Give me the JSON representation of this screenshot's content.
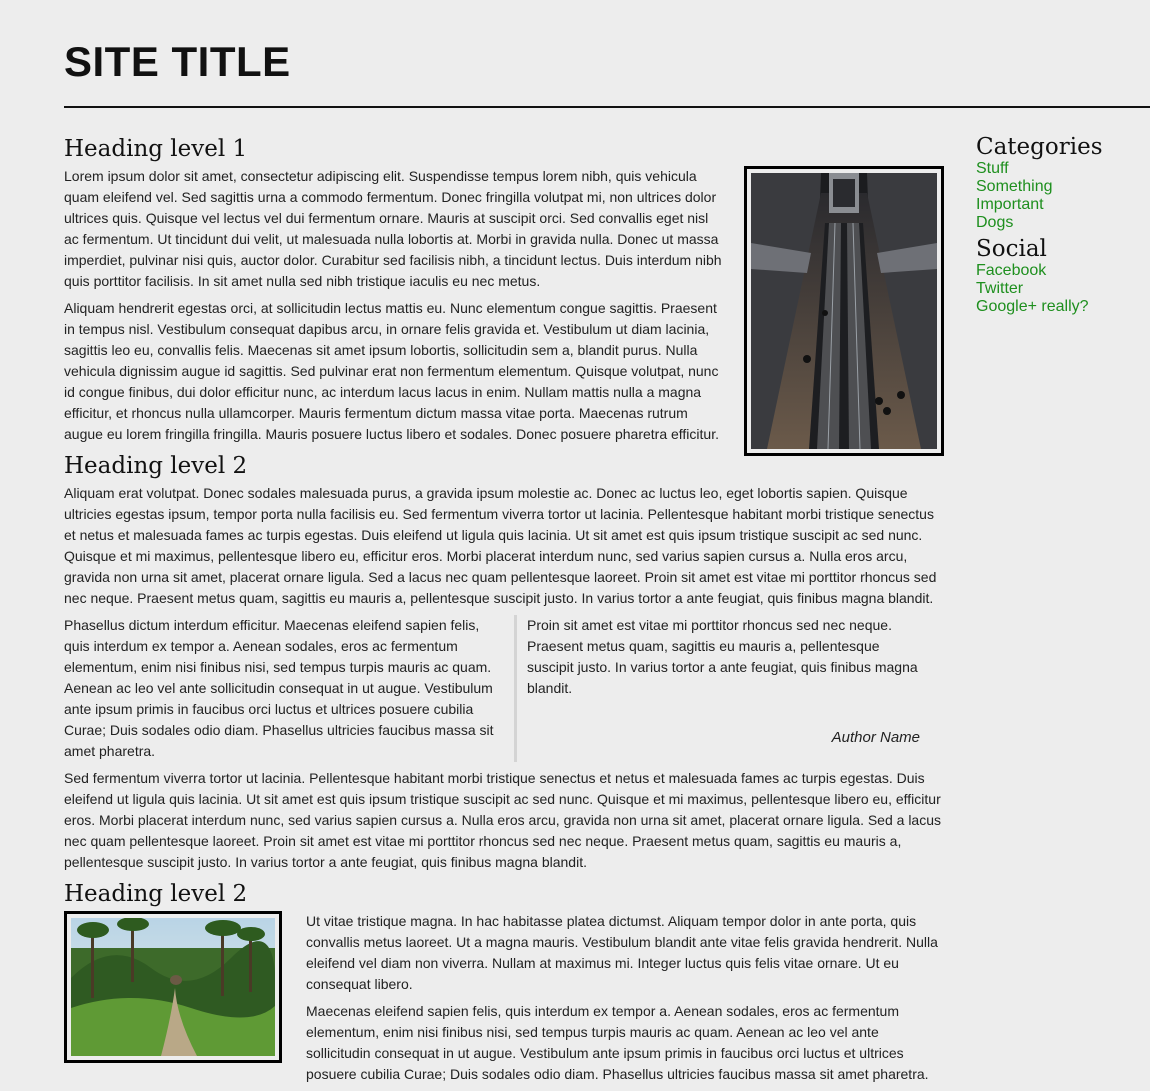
{
  "site": {
    "title": "SITE TITLE"
  },
  "main": {
    "section1": {
      "heading": "Heading level 1",
      "paragraphs": [
        "Lorem ipsum dolor sit amet, consectetur adipiscing elit. Suspendisse tempus lorem nibh, quis vehicula quam eleifend vel. Sed sagittis urna a commodo fermentum. Donec fringilla volutpat mi, non ultrices dolor ultrices quis. Quisque vel lectus vel dui fermentum ornare. Mauris at suscipit orci. Sed convallis eget nisl ac fermentum. Ut tincidunt dui velit, ut malesuada nulla lobortis at. Morbi in gravida nulla. Donec ut massa imperdiet, pulvinar nisi quis, auctor dolor. Curabitur sed facilisis nibh, a tincidunt lectus. Duis interdum nibh quis porttitor facilisis. In sit amet nulla sed nibh tristique iaculis eu nec metus.",
        "Aliquam hendrerit egestas orci, at sollicitudin lectus mattis eu. Nunc elementum congue sagittis. Praesent in tempus nisl. Vestibulum consequat dapibus arcu, in ornare felis gravida et. Vestibulum ut diam lacinia, sagittis leo eu, convallis felis. Maecenas sit amet ipsum lobortis, sollicitudin sem a, blandit purus. Nulla vehicula dignissim augue id sagittis. Sed pulvinar erat non fermentum elementum. Quisque volutpat, nunc id congue finibus, dui dolor efficitur nunc, ac interdum lacus lacus in enim. Nullam mattis nulla a magna efficitur, et rhoncus nulla ullamcorper. Mauris fermentum dictum massa vitae porta. Maecenas rutrum augue eu lorem fringilla fringilla. Mauris posuere luctus libero et sodales. Donec posuere pharetra efficitur."
      ]
    },
    "section2": {
      "heading": "Heading level 2",
      "intro": "Aliquam erat volutpat. Donec sodales malesuada purus, a gravida ipsum molestie ac. Donec ac luctus leo, eget lobortis sapien. Quisque ultricies egestas ipsum, tempor porta nulla facilisis eu. Sed fermentum viverra tortor ut lacinia. Pellentesque habitant morbi tristique senectus et netus et malesuada fames ac turpis egestas. Duis eleifend ut ligula quis lacinia. Ut sit amet est quis ipsum tristique suscipit ac sed nunc. Quisque et mi maximus, pellentesque libero eu, efficitur eros. Morbi placerat interdum nunc, sed varius sapien cursus a. Nulla eros arcu, gravida non urna sit amet, placerat ornare ligula. Sed a lacus nec quam pellentesque laoreet. Proin sit amet est vitae mi porttitor rhoncus sed nec neque. Praesent metus quam, sagittis eu mauris a, pellentesque suscipit justo. In varius tortor a ante feugiat, quis finibus magna blandit.",
      "col_left": "Phasellus dictum interdum efficitur. Maecenas eleifend sapien felis, quis interdum ex tempor a. Aenean sodales, eros ac fermentum elementum, enim nisi finibus nisi, sed tempus turpis mauris ac quam. Aenean ac leo vel ante sollicitudin consequat in ut augue. Vestibulum ante ipsum primis in faucibus orci luctus et ultrices posuere cubilia Curae; Duis sodales odio diam. Phasellus ultricies faucibus massa sit amet pharetra.",
      "quote": "Proin sit amet est vitae mi porttitor rhoncus sed nec neque. Praesent metus quam, sagittis eu mauris a, pellentesque suscipit justo. In varius tortor a ante feugiat, quis finibus magna blandit.",
      "author": "Author Name",
      "outro": "Sed fermentum viverra tortor ut lacinia. Pellentesque habitant morbi tristique senectus et netus et malesuada fames ac turpis egestas. Duis eleifend ut ligula quis lacinia. Ut sit amet est quis ipsum tristique suscipit ac sed nunc. Quisque et mi maximus, pellentesque libero eu, efficitur eros. Morbi placerat interdum nunc, sed varius sapien cursus a. Nulla eros arcu, gravida non urna sit amet, placerat ornare ligula. Sed a lacus nec quam pellentesque laoreet. Proin sit amet est vitae mi porttitor rhoncus sed nec neque. Praesent metus quam, sagittis eu mauris a, pellentesque suscipit justo. In varius tortor a ante feugiat, quis finibus magna blandit."
    },
    "section3": {
      "heading": "Heading level 2",
      "paragraphs": [
        "Ut vitae tristique magna. In hac habitasse platea dictumst. Aliquam tempor dolor in ante porta, quis convallis metus laoreet. Ut a magna mauris. Vestibulum blandit ante vitae felis gravida hendrerit. Nulla eleifend vel diam non viverra. Nullam at maximus mi. Integer luctus quis felis vitae ornare. Ut eu consequat libero.",
        "Maecenas eleifend sapien felis, quis interdum ex tempor a. Aenean sodales, eros ac fermentum elementum, enim nisi finibus nisi, sed tempus turpis mauris ac quam. Aenean ac leo vel ante sollicitudin consequat in ut augue. Vestibulum ante ipsum primis in faucibus orci luctus et ultrices posuere cubilia Curae; Duis sodales odio diam. Phasellus ultricies faucibus massa sit amet pharetra."
      ]
    }
  },
  "sidebar": {
    "categories": {
      "heading": "Categories",
      "items": [
        "Stuff",
        "Something",
        "Important",
        "Dogs"
      ]
    },
    "social": {
      "heading": "Social",
      "items": [
        "Facebook",
        "Twitter",
        "Google+ really?"
      ]
    },
    "link_color": "#1e8f1e"
  }
}
